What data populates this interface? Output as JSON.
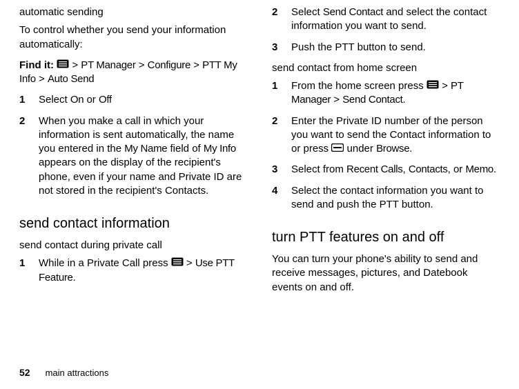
{
  "left": {
    "heading_auto": "automatic sending",
    "auto_intro": "To control whether you send your information automatically:",
    "find_label": "Find it:",
    "find_seq1": "PT Manager",
    "find_seq2": "Configure",
    "find_seq3": "PTT My Info",
    "find_seq4": "Auto Send",
    "step1_pre": "Select ",
    "step1_on": "On",
    "step1_mid": " or ",
    "step1_off": "Off",
    "step2a": "When you make a call in which your information is sent automatically, the name you entered in the ",
    "step2b": "My Name",
    "step2c": " field of ",
    "step2d": "My Info",
    "step2e": " appears on the display of the recipient's phone, even if your name and Private ID are not stored in the recipient's Contacts.",
    "heading_send": "send contact information",
    "heading_priv": "send contact during private call",
    "priv1a": "While in a Private Call press ",
    "priv1b": "Use PTT Feature",
    "priv1c": "."
  },
  "right": {
    "r2a": "Select ",
    "r2b": "Send Contact",
    "r2c": " and select the contact information you want to send.",
    "r3": "Push the PTT button to send.",
    "heading_home": "send contact from home screen",
    "h1a": "From the home screen press ",
    "h1b": "PT Manager",
    "h1c": "Send Contact.",
    "h2a": "Enter the Private ID number of the person you want to send the Contact information to or press ",
    "h2b": " under ",
    "h2c": "Browse",
    "h2d": ".",
    "h3a": "Select from ",
    "h3b": "Recent Calls",
    "h3c": ", ",
    "h3d": "Contacts",
    "h3e": ", or ",
    "h3f": "Memo",
    "h3g": ".",
    "h4": "Select the contact information you want to send and push the PTT button.",
    "heading_turn": "turn PTT features on and off",
    "turn_p": "You can turn your phone's ability to send and receive messages, pictures, and Datebook events on and off."
  },
  "footer": {
    "page": "52",
    "title": "main attractions"
  },
  "sep": " > "
}
